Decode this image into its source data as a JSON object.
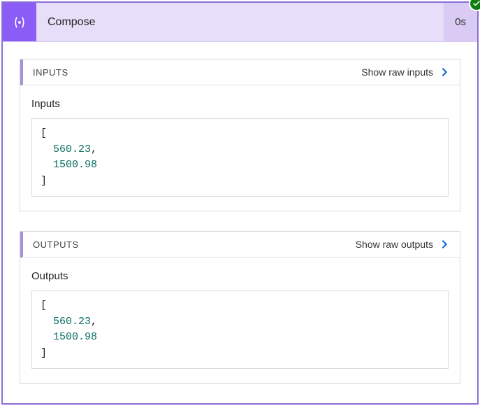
{
  "header": {
    "title": "Compose",
    "duration": "0s"
  },
  "inputs": {
    "header_label": "INPUTS",
    "show_raw_label": "Show raw inputs",
    "sub_label": "Inputs",
    "values": [
      560.23,
      1500.98
    ]
  },
  "outputs": {
    "header_label": "OUTPUTS",
    "show_raw_label": "Show raw outputs",
    "sub_label": "Outputs",
    "values": [
      560.23,
      1500.98
    ]
  }
}
